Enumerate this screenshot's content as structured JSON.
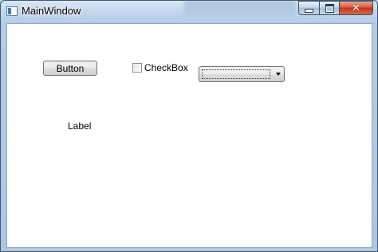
{
  "window": {
    "title": "MainWindow"
  },
  "caption_buttons": {
    "minimize_icon": "minimize-icon",
    "maximize_icon": "maximize-icon",
    "close_icon": "close-icon",
    "close_glyph": "✕"
  },
  "content": {
    "button_label": "Button",
    "checkbox": {
      "label": "CheckBox",
      "checked": false
    },
    "combobox": {
      "selected_value": ""
    },
    "label_text": "Label"
  },
  "colors": {
    "close_button": "#c2351a",
    "title_bar": "#c2d6ec",
    "client_background": "#ffffff"
  }
}
